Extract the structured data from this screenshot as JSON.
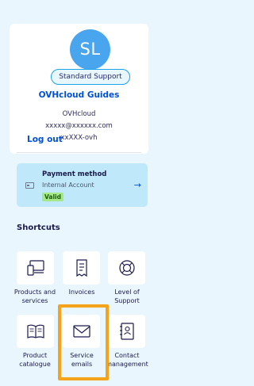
{
  "profile": {
    "initials": "SL",
    "support_level": "Standard Support",
    "guides_link": "OVHcloud Guides",
    "company": "OVHcloud",
    "email": "xxxxx@xxxxxx.com",
    "nichandle": "xxXXX-ovh",
    "logout_label": "Log out"
  },
  "payment": {
    "title": "Payment method",
    "subtitle": "Internal Account",
    "status": "Valid",
    "icon": "credit-card-icon",
    "arrow_icon": "arrow-right-icon"
  },
  "shortcuts": {
    "title": "Shortcuts",
    "items": [
      {
        "label_line1": "Products and",
        "label_line2": "services",
        "icon": "devices-icon"
      },
      {
        "label_line1": "Invoices",
        "label_line2": "",
        "icon": "invoice-icon"
      },
      {
        "label_line1": "Level of",
        "label_line2": "Support",
        "icon": "lifebuoy-icon"
      },
      {
        "label_line1": "Product",
        "label_line2": "catalogue",
        "icon": "book-icon"
      },
      {
        "label_line1": "Service",
        "label_line2": "emails",
        "icon": "envelope-icon"
      },
      {
        "label_line1": "Contact",
        "label_line2": "management",
        "icon": "contact-book-icon"
      }
    ]
  },
  "colors": {
    "background": "#e9f6fd",
    "accent": "#0050d7",
    "avatar": "#4aa5ef",
    "highlight": "#f5a31a",
    "valid_badge": "#a5e887"
  }
}
